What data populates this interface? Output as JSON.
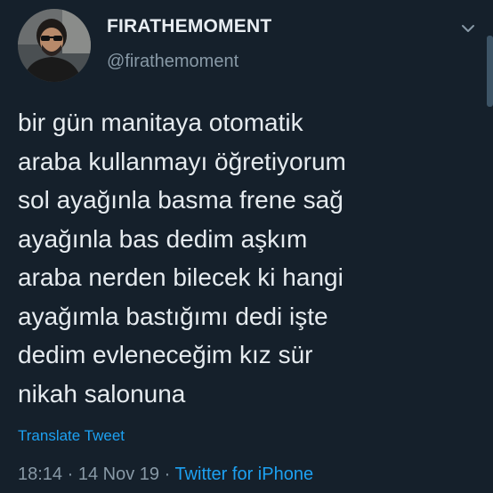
{
  "user": {
    "display_name": "FIRATHEMOMENT",
    "handle": "@firathemoment"
  },
  "tweet": {
    "lines": [
      "bir gün manitaya otomatik",
      "araba kullanmayı öğretiyorum",
      "sol ayağınla basma frene sağ",
      "ayağınla bas dedim aşkım",
      "araba nerden bilecek ki hangi",
      "ayağımla bastığımı dedi işte",
      "dedim evleneceğim kız sür",
      "nikah salonuna"
    ],
    "translate_label": "Translate Tweet"
  },
  "meta": {
    "time": "18:14",
    "separator_1": " · ",
    "date": "14 Nov 19",
    "separator_2": " · ",
    "source": "Twitter for iPhone"
  },
  "icons": {
    "avatar": "profile-photo",
    "menu": "chevron-down-icon"
  },
  "colors": {
    "background": "#15202b",
    "accent": "#1da1f2",
    "secondary_text": "#8899a6",
    "primary_text": "#e6ebef"
  }
}
